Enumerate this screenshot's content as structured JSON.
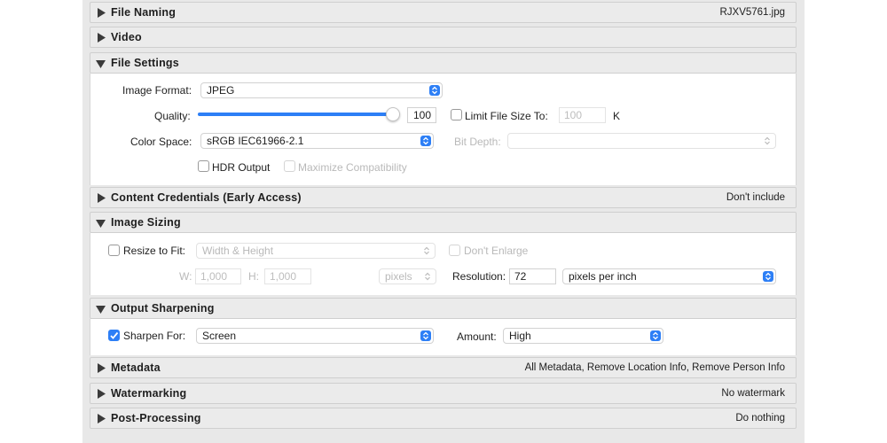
{
  "colors": {
    "accent": "#2d7ff6",
    "panel": "#e8e8e8",
    "header": "#ebebeb"
  },
  "sections": {
    "file_naming": {
      "title": "File Naming",
      "summary": "RJXV5761.jpg",
      "state": "collapsed"
    },
    "video": {
      "title": "Video",
      "state": "collapsed"
    },
    "file_settings": {
      "title": "File Settings",
      "state": "expanded"
    },
    "content_credentials": {
      "title": "Content Credentials (Early Access)",
      "summary": "Don't include",
      "state": "collapsed"
    },
    "image_sizing": {
      "title": "Image Sizing",
      "state": "expanded"
    },
    "output_sharpening": {
      "title": "Output Sharpening",
      "state": "expanded"
    },
    "metadata": {
      "title": "Metadata",
      "summary": "All Metadata, Remove Location Info, Remove Person Info",
      "state": "collapsed"
    },
    "watermarking": {
      "title": "Watermarking",
      "summary": "No watermark",
      "state": "collapsed"
    },
    "post_processing": {
      "title": "Post-Processing",
      "summary": "Do nothing",
      "state": "collapsed"
    }
  },
  "file_settings": {
    "image_format_label": "Image Format:",
    "image_format": "JPEG",
    "quality_label": "Quality:",
    "quality": "100",
    "quality_fraction": 1.0,
    "limit_size_label": "Limit File Size To:",
    "limit_size_value": "100",
    "limit_size_unit": "K",
    "limit_size_checked": false,
    "color_space_label": "Color Space:",
    "color_space": "sRGB IEC61966-2.1",
    "bit_depth_label": "Bit Depth:",
    "bit_depth": "",
    "hdr_output_label": "HDR Output",
    "hdr_output_checked": false,
    "maximize_compat_label": "Maximize Compatibility",
    "maximize_compat_checked": false
  },
  "image_sizing": {
    "resize_label": "Resize to Fit:",
    "resize_checked": false,
    "resize_mode": "Width & Height",
    "dont_enlarge_label": "Don't Enlarge",
    "w_label": "W:",
    "w_value": "1,000",
    "h_label": "H:",
    "h_value": "1,000",
    "units": "pixels",
    "resolution_label": "Resolution:",
    "resolution": "72",
    "resolution_units": "pixels per inch"
  },
  "output_sharpening": {
    "sharpen_label": "Sharpen For:",
    "sharpen_checked": true,
    "sharpen_for": "Screen",
    "amount_label": "Amount:",
    "amount": "High"
  },
  "icons": {
    "collapsed": "disclosure-right-icon",
    "expanded": "disclosure-down-icon",
    "stepper": "chevron-updown-icon",
    "check": "checkmark-icon"
  }
}
